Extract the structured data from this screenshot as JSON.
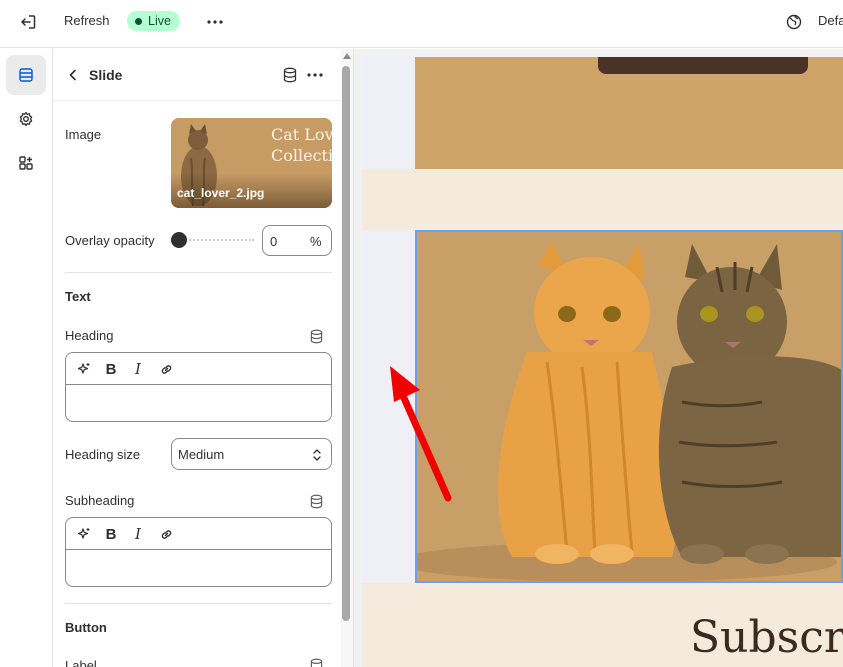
{
  "topbar": {
    "title": "Refresh",
    "badge": "Live",
    "right_label": "Defa"
  },
  "rail": {
    "items": [
      {
        "icon": "sections-icon",
        "active": true
      },
      {
        "icon": "gear-icon",
        "active": false
      },
      {
        "icon": "apps-icon",
        "active": false
      }
    ]
  },
  "panel": {
    "title": "Slide",
    "image": {
      "label": "Image",
      "filename": "cat_lover_2.jpg",
      "thumb_title_line1": "Cat Lov",
      "thumb_title_line2": "Collectio"
    },
    "overlay": {
      "label": "Overlay opacity",
      "value": "0",
      "unit": "%",
      "level_percent": 0
    },
    "text_section": "Text",
    "heading": {
      "label": "Heading",
      "value": ""
    },
    "heading_size": {
      "label": "Heading size",
      "value": "Medium"
    },
    "subheading": {
      "label": "Subheading",
      "value": ""
    },
    "button_section": "Button",
    "label_field": "Label"
  },
  "preview": {
    "subscribe_text": "Subscri"
  },
  "colors": {
    "accent_green": "#b4fed2",
    "selection_blue": "#6ea0e6",
    "arrow_red": "#f00000"
  }
}
